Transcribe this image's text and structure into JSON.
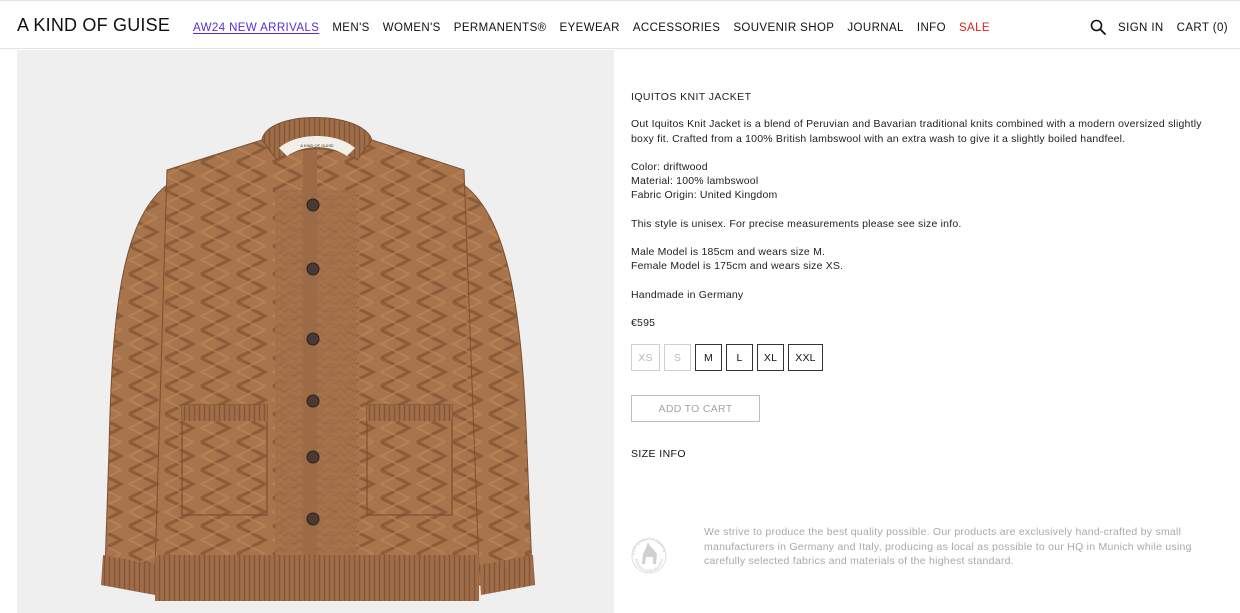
{
  "header": {
    "logo": "A KIND OF GUISE",
    "nav": [
      {
        "label": "AW24 NEW ARRIVALS"
      },
      {
        "label": "MEN'S"
      },
      {
        "label": "WOMEN'S"
      },
      {
        "label": "PERMANENTS®"
      },
      {
        "label": "EYEWEAR"
      },
      {
        "label": "ACCESSORIES"
      },
      {
        "label": "SOUVENIR SHOP"
      },
      {
        "label": "JOURNAL"
      },
      {
        "label": "INFO"
      },
      {
        "label": "SALE"
      }
    ],
    "sign_in": "SIGN IN",
    "cart": "CART (0)"
  },
  "product": {
    "image_icon": "cardigan-photo",
    "label_text": "A KIND OF GUISE",
    "title": "IQUITOS KNIT JACKET",
    "description": "Out Iquitos Knit Jacket is a blend of Peruvian and Bavarian traditional knits combined with a modern oversized slightly boxy fit. Crafted from a 100% British lambswool with an extra wash to give it a slightly boiled handfeel.",
    "color": "Color: driftwood",
    "material": "Material: 100% lambswool",
    "origin": "Fabric Origin: United Kingdom",
    "unisex_note": "This style is unisex. For precise measurements please see size info.",
    "male_model": "Male Model is 185cm and wears size M.",
    "female_model": "Female Model is 175cm and wears size XS.",
    "made_in": "Handmade in Germany",
    "price": "€595",
    "sizes": [
      {
        "label": "XS",
        "available": false
      },
      {
        "label": "S",
        "available": false
      },
      {
        "label": "M",
        "available": true
      },
      {
        "label": "L",
        "available": true
      },
      {
        "label": "XL",
        "available": true
      },
      {
        "label": "XXL",
        "available": true
      }
    ],
    "add_to_cart": "ADD TO CART",
    "size_info": "SIZE INFO"
  },
  "quality": {
    "badge_icon": "quality-seal-icon",
    "badge_top": "AKOG QUALITY CONTROL",
    "badge_bottom": "GERMAN ENGINEERING",
    "text": "We strive to produce the best quality possible. Our products are exclusively hand-crafted by small manufacturers in Germany and Italy, producing as local as possible to our HQ in Munich while using carefully selected fabrics and materials of the highest standard."
  },
  "colors": {
    "accent_link": "#5b2ad1",
    "sale": "#e0201c",
    "knit": "#a4714a"
  }
}
